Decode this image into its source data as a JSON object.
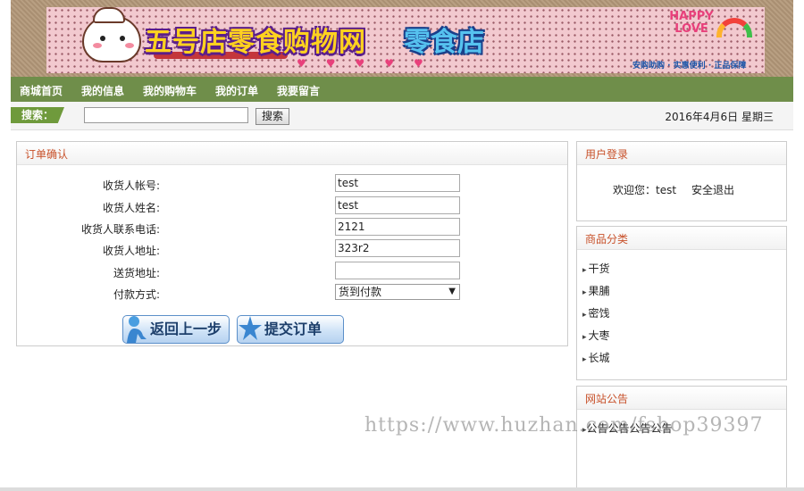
{
  "banner": {
    "title": "五号店零食购物网",
    "store": "零食店",
    "happy": "HAPPY LOVE",
    "badges": "安购助购 · 实惠便利 · 正品保障"
  },
  "nav": {
    "items": [
      "商城首页",
      "我的信息",
      "我的购物车",
      "我的订单",
      "我要留言"
    ]
  },
  "search": {
    "label": "搜索：",
    "button": "搜索",
    "value": ""
  },
  "date": "2016年4月6日 星期三",
  "order": {
    "title": "订单确认",
    "fields": [
      {
        "label": "收货人帐号:",
        "value": "test"
      },
      {
        "label": "收货人姓名:",
        "value": "test"
      },
      {
        "label": "收货人联系电话:",
        "value": "2121"
      },
      {
        "label": "收货人地址:",
        "value": "323r2"
      },
      {
        "label": "送货地址:",
        "value": ""
      }
    ],
    "payment_label": "付款方式:",
    "payment_value": "货到付款",
    "back_button": "返回上一步",
    "submit_button": "提交订单"
  },
  "login": {
    "title": "用户登录",
    "welcome": "欢迎您：test",
    "logout": "安全退出"
  },
  "categories": {
    "title": "商品分类",
    "items": [
      "干货",
      "果脯",
      "密饯",
      "大枣",
      "长城"
    ]
  },
  "notice": {
    "title": "网站公告",
    "text": "公告公告公告公告"
  },
  "watermark": "https://www.huzhan.com/fshop39397"
}
